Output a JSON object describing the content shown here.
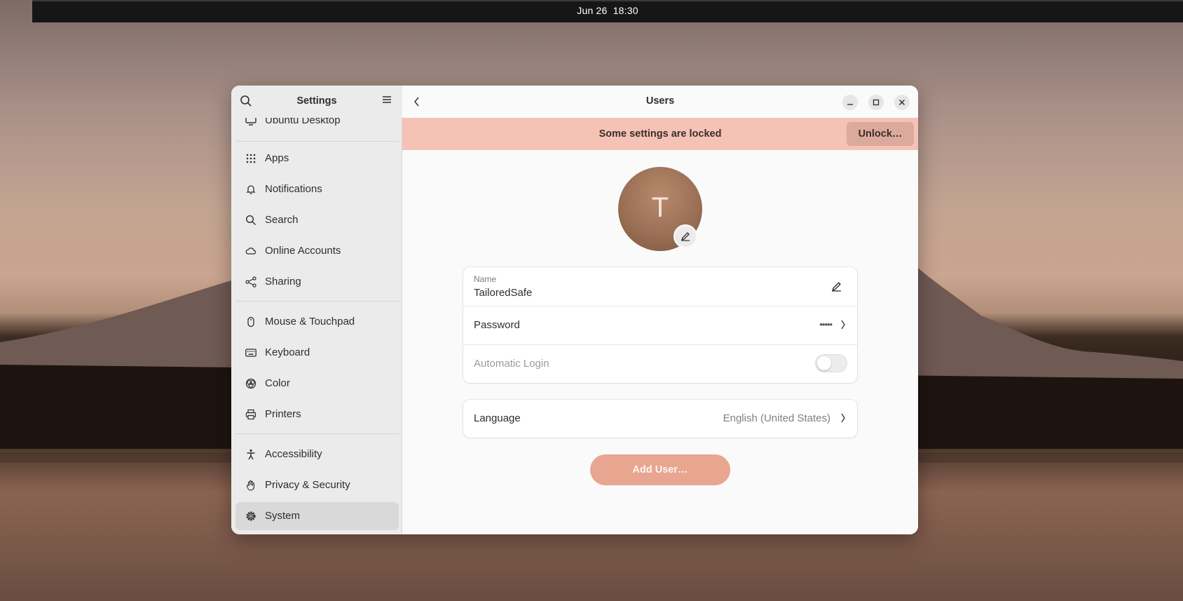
{
  "topbar": {
    "date": "Jun 26",
    "time": "18:30"
  },
  "sidebar": {
    "title": "Settings",
    "partial_item": "Ubuntu Desktop",
    "groups": [
      [
        {
          "label": "Apps",
          "icon": "apps-icon"
        },
        {
          "label": "Notifications",
          "icon": "bell-icon"
        },
        {
          "label": "Search",
          "icon": "search-icon"
        },
        {
          "label": "Online Accounts",
          "icon": "cloud-icon"
        },
        {
          "label": "Sharing",
          "icon": "share-icon"
        }
      ],
      [
        {
          "label": "Mouse & Touchpad",
          "icon": "mouse-icon"
        },
        {
          "label": "Keyboard",
          "icon": "keyboard-icon"
        },
        {
          "label": "Color",
          "icon": "color-icon"
        },
        {
          "label": "Printers",
          "icon": "printer-icon"
        }
      ],
      [
        {
          "label": "Accessibility",
          "icon": "accessibility-icon"
        },
        {
          "label": "Privacy & Security",
          "icon": "hand-icon"
        },
        {
          "label": "System",
          "icon": "gear-icon",
          "selected": true
        }
      ]
    ]
  },
  "header": {
    "title": "Users"
  },
  "banner": {
    "text": "Some settings are locked",
    "unlock_label": "Unlock…"
  },
  "user": {
    "initial": "T",
    "name_caption": "Name",
    "name_value": "TailoredSafe",
    "password_label": "Password",
    "password_value": "•••••",
    "autologin_label": "Automatic Login",
    "autologin_enabled": false,
    "language_label": "Language",
    "language_value": "English (United States)",
    "add_user_label": "Add User…"
  },
  "colors": {
    "banner_bg": "#f5c3b5",
    "accent": "#e8a590",
    "selected_item": "#d9d9d9"
  }
}
